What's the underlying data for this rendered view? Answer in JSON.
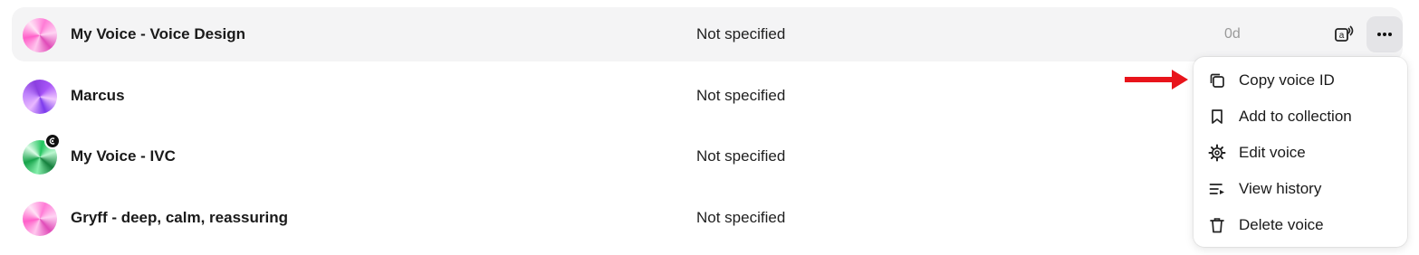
{
  "voices": [
    {
      "name": "My Voice - Voice Design",
      "category": "Not specified",
      "age": "0d"
    },
    {
      "name": "Marcus",
      "category": "Not specified"
    },
    {
      "name": "My Voice - IVC",
      "category": "Not specified"
    },
    {
      "name": "Gryff - deep, calm, reassuring",
      "category": "Not specified"
    }
  ],
  "menu": {
    "items": [
      {
        "label": "Copy voice ID",
        "icon": "copy-icon"
      },
      {
        "label": "Add to collection",
        "icon": "bookmark-icon"
      },
      {
        "label": "Edit voice",
        "icon": "gear-icon"
      },
      {
        "label": "View history",
        "icon": "history-list-icon"
      },
      {
        "label": "Delete voice",
        "icon": "trash-icon"
      }
    ]
  },
  "colors": {
    "accent_arrow": "#e8141b",
    "row_highlight": "#f4f4f5",
    "button_bg": "#e4e4e7"
  }
}
